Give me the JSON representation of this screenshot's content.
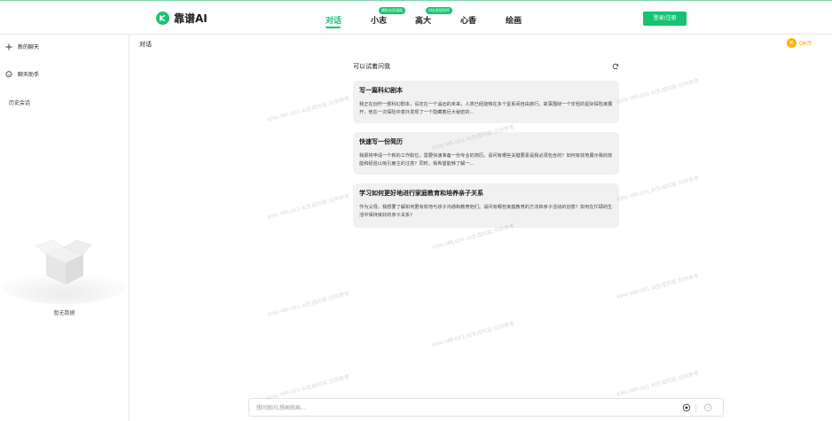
{
  "header": {
    "logo_text": "靠谱AI",
    "nav": [
      {
        "label": "对话",
        "active": true
      },
      {
        "label": "小志",
        "badge": "模拟志愿填报"
      },
      {
        "label": "高大",
        "badge": "AI志愿规划师"
      },
      {
        "label": "心香"
      },
      {
        "label": "绘画"
      }
    ],
    "login_label": "登录/注册"
  },
  "sidebar": {
    "new_chat": "新的聊天",
    "assistant": "聊天助手",
    "history_label": "历史会话",
    "empty_text": "暂无数据"
  },
  "main": {
    "page_title": "对话",
    "coin_label": "OK币",
    "coin_symbol": "K",
    "try_title": "可以试着问我",
    "cards": [
      {
        "title": "写一篇科幻剧本",
        "desc": "我正在创作一部科幻剧本，设定在一个遥远的未来，人类已经能够在多个星系间自由旅行。故事围绕一个年轻的星际探险家展开，他在一次探险中意外发现了一个隐藏着巨大秘密的..."
      },
      {
        "title": "快速写一份简历",
        "desc": "我即将申请一个新的工作职位，需要快速准备一份专业的简历。请问有哪些关键要素是我必须包含的？如何有效地展示我的技能和经验以吸引雇主的注意？同时，我希望能够了解一..."
      },
      {
        "title": "学习如何更好地进行家庭教育和培养亲子关系",
        "desc": "作为父母，我想要了解如何更有效地与孩子沟通和教育他们。请问有哪些家庭教育的方法和亲子活动的创意？如何在忙碌的生活中保持良好的亲子关系？"
      }
    ],
    "input_placeholder": "想问就问,想画就画..."
  },
  "watermark_text": "KPAI MR-001  AI生成内容,仅供参考",
  "colors": {
    "accent": "#16c372",
    "coin": "#ffb400"
  }
}
